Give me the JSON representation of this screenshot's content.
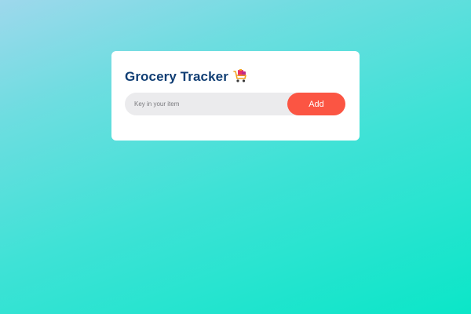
{
  "app": {
    "title": "Grocery Tracker",
    "title_icon": "shopping-cart-icon"
  },
  "form": {
    "input_value": "",
    "input_placeholder": "Key in your item",
    "add_label": "Add"
  },
  "colors": {
    "title": "#103e74",
    "accent": "#fb5543",
    "input_bg": "#ebebed",
    "card_bg": "#ffffff",
    "background_start": "#9ed8ec",
    "background_end": "#0be6c8"
  }
}
